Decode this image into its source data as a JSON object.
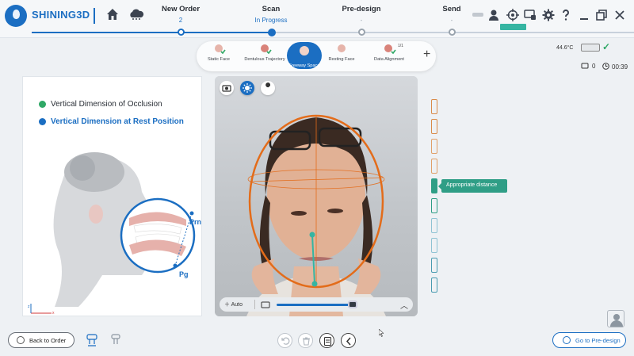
{
  "header": {
    "brand": "SHINING3D",
    "steps": [
      {
        "title": "New Order",
        "status": "2"
      },
      {
        "title": "Scan",
        "status": "In Progress"
      },
      {
        "title": "Pre-design",
        "status": "-"
      },
      {
        "title": "Send",
        "status": "-"
      }
    ],
    "icons": [
      "home-icon",
      "cloud-icon",
      "user-icon",
      "target-icon",
      "screen-share-icon",
      "settings-icon",
      "help-icon",
      "minimize-icon",
      "restore-icon",
      "close-icon"
    ]
  },
  "substeps": [
    {
      "label": "Static Face"
    },
    {
      "label": "Dentulous Trajectory"
    },
    {
      "label": "Freeway Space"
    },
    {
      "label": "Resting Face"
    },
    {
      "label": "Data Alignment",
      "badge": "1/1"
    }
  ],
  "status": {
    "temperature": "44.6°C",
    "messages": "0",
    "timer": "00:39"
  },
  "left_panel": {
    "items": [
      {
        "text": "Vertical Dimension of Occlusion",
        "state": "done"
      },
      {
        "text": "Vertical Dimension at Rest Position",
        "state": "active"
      }
    ],
    "landmarks": [
      "Prn",
      "Pg"
    ],
    "axis": {
      "x": "x",
      "z": "z"
    }
  },
  "camera": {
    "auto_label": "Auto",
    "tools": [
      "camera-icon",
      "brightness-icon",
      "wrench-icon"
    ],
    "exposure_fraction": 0.86
  },
  "distance": {
    "tooltip": "Appropriate distance",
    "colors": {
      "far": "#d98b4a",
      "ok": "#2f9e86",
      "near": "#4a9bb0"
    }
  },
  "footer": {
    "back_label": "Back to Order",
    "next_label": "Go to Pre-design"
  },
  "colors": {
    "accent": "#1b6ec2",
    "teal": "#35b5a2",
    "orange": "#e36c1a"
  }
}
